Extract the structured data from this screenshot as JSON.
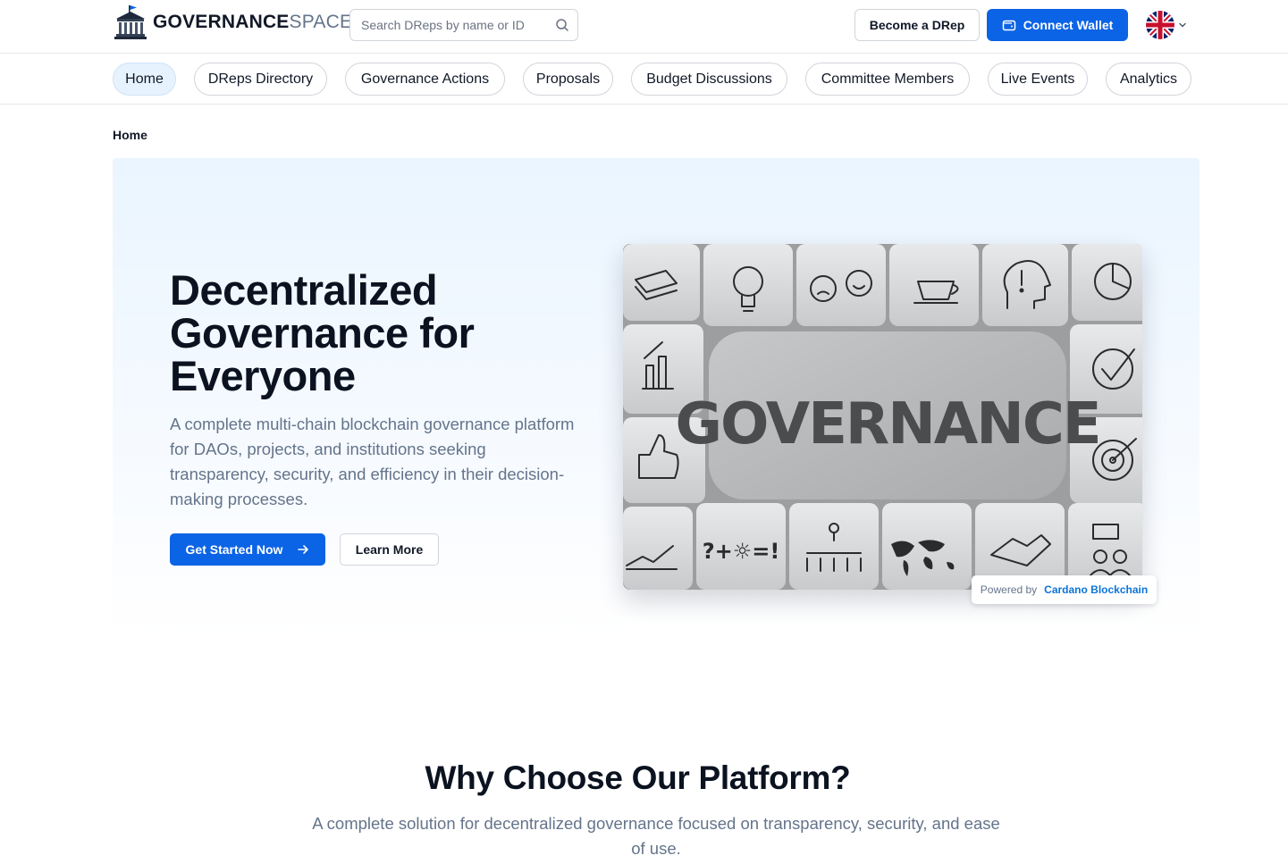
{
  "header": {
    "logo": {
      "bold": "GOVERNANCE",
      "light": "SPACE",
      "icon": "bank-building-icon"
    },
    "search": {
      "placeholder": "Search DReps by name or ID",
      "icon": "search-icon"
    },
    "become_drep_label": "Become a DRep",
    "connect_wallet_label": "Connect Wallet",
    "language": {
      "flag": "uk-flag-icon",
      "chevron": "chevron-down-icon"
    }
  },
  "nav": {
    "items": [
      {
        "label": "Home",
        "active": true
      },
      {
        "label": "DReps Directory",
        "active": false
      },
      {
        "label": "Governance Actions",
        "active": false
      },
      {
        "label": "Proposals",
        "active": false
      },
      {
        "label": "Budget Discussions",
        "active": false
      },
      {
        "label": "Committee Members",
        "active": false
      },
      {
        "label": "Live Events",
        "active": false
      },
      {
        "label": "Analytics",
        "active": false
      }
    ]
  },
  "breadcrumb": {
    "current": "Home"
  },
  "hero": {
    "title": "Decentralized Governance for Everyone",
    "subtitle": "A complete multi-chain blockchain governance platform for DAOs, projects, and institutions seeking transparency, security, and efficiency in their decision-making processes.",
    "cta_label": "Get Started Now",
    "learn_label": "Learn More",
    "image_word": "GOVERNANCE",
    "powered_prefix": "Powered by",
    "powered_chain": "Cardano Blockchain"
  },
  "why": {
    "title": "Why Choose Our Platform?",
    "subtitle": "A complete solution for decentralized governance focused on transparency, security, and ease of use."
  },
  "colors": {
    "primary": "#0b63e5",
    "nav_active_bg": "#e6f2fd",
    "muted_text": "#64748b",
    "chain_link": "#0b74d8"
  }
}
